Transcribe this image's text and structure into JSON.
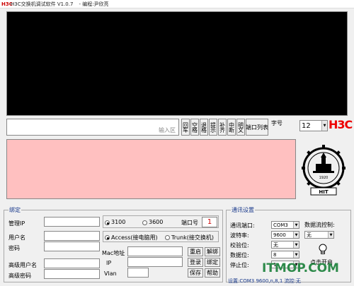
{
  "window": {
    "logo": "H3C",
    "title": "H3C交换机调试软件 V1.0.7",
    "author": "- 编程:尹欣亮"
  },
  "input_hint": "输入区",
  "vbuttons": [
    "回车",
    "空格",
    "退格",
    "提示",
    "补齐",
    "中断",
    "明文"
  ],
  "port_list_label": "端口列表",
  "font_size_label": "字号",
  "font_size_value": "12",
  "brand_logo": "H3C",
  "emblem": {
    "text": "HIT",
    "year": "1920"
  },
  "bind_group": {
    "title": "绑定",
    "mgmt_ip_label": "管理IP",
    "username_label": "用户名",
    "password_label": "密码",
    "adv_username_label": "高级用户名",
    "adv_password_label": "高级密码",
    "model_3100": "3100",
    "model_3600": "3600",
    "port_label": "端口号",
    "port_value": "1",
    "access_label": "Access(接电脑用)",
    "trunk_label": "Trunk(接交换机)",
    "mac_label": "Mac地址",
    "ip_label": "IP",
    "vlan_label": "Vlan",
    "restart": "重启",
    "login": "登录",
    "save": "保存",
    "unbind": "解绑",
    "bind": "绑定",
    "help": "帮助"
  },
  "comm_group": {
    "title": "通讯设置",
    "port_label": "通讯端口:",
    "port_value": "COM3",
    "baud_label": "波特率:",
    "baud_value": "9600",
    "parity_label": "校验位:",
    "parity_value": "无",
    "databits_label": "数据位:",
    "databits_value": "8",
    "stopbits_label": "停止位:",
    "stopbits_value": "1",
    "flow_label": "数据流控制:",
    "flow_value": "无",
    "open_label": "点击开启",
    "status_text": "设置:COM3 9600,n,8,1 流控:无"
  },
  "watermark": "ITMOP.COM"
}
